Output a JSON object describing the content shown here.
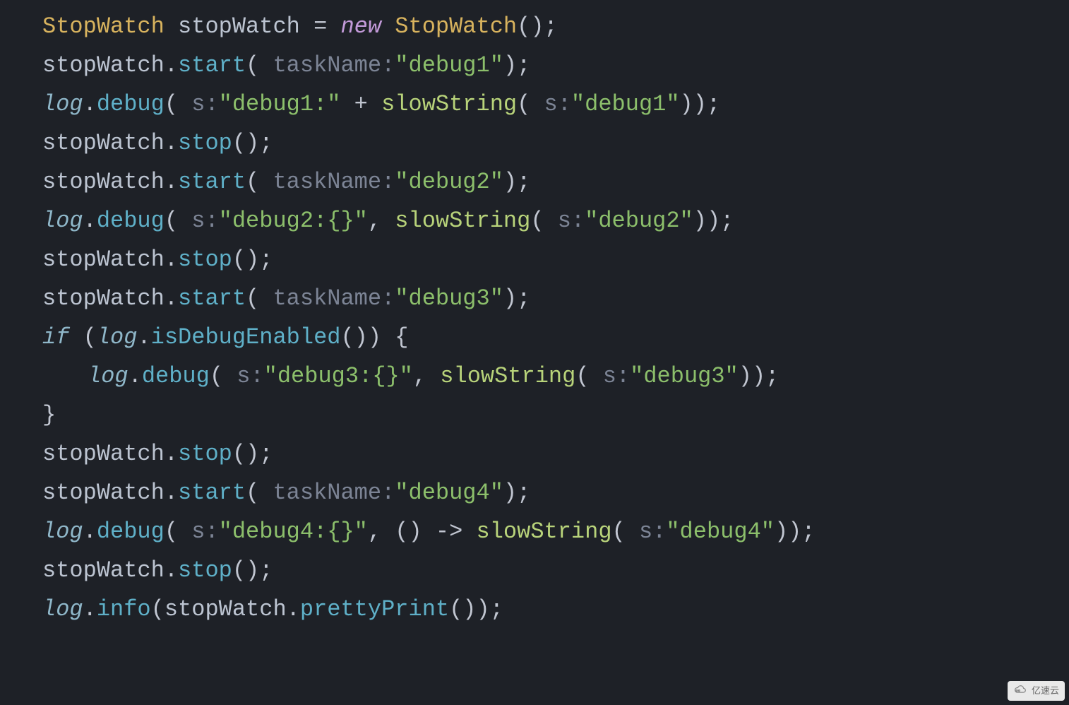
{
  "lines": [
    [
      {
        "t": "StopWatch",
        "c": "cls"
      },
      {
        "t": " ",
        "c": "var"
      },
      {
        "t": "stopWatch",
        "c": "var"
      },
      {
        "t": " = ",
        "c": "op"
      },
      {
        "t": "new",
        "c": "kw"
      },
      {
        "t": " ",
        "c": "var"
      },
      {
        "t": "StopWatch",
        "c": "cls"
      },
      {
        "t": "();",
        "c": "pun"
      }
    ],
    [
      {
        "t": "stopWatch",
        "c": "var"
      },
      {
        "t": ".",
        "c": "pun"
      },
      {
        "t": "start",
        "c": "mth"
      },
      {
        "t": "(",
        "c": "pun"
      },
      {
        "t": " taskName:",
        "c": "par"
      },
      {
        "t": "\"debug1\"",
        "c": "str"
      },
      {
        "t": ");",
        "c": "pun"
      }
    ],
    [
      {
        "t": "log",
        "c": "sta"
      },
      {
        "t": ".",
        "c": "pun"
      },
      {
        "t": "debug",
        "c": "mth"
      },
      {
        "t": "(",
        "c": "pun"
      },
      {
        "t": " s:",
        "c": "par"
      },
      {
        "t": "\"debug1:\"",
        "c": "str"
      },
      {
        "t": " + ",
        "c": "op"
      },
      {
        "t": "slowString",
        "c": "mth2"
      },
      {
        "t": "(",
        "c": "pun"
      },
      {
        "t": " s:",
        "c": "par"
      },
      {
        "t": "\"debug1\"",
        "c": "str"
      },
      {
        "t": "));",
        "c": "pun"
      }
    ],
    [
      {
        "t": "stopWatch",
        "c": "var"
      },
      {
        "t": ".",
        "c": "pun"
      },
      {
        "t": "stop",
        "c": "mth"
      },
      {
        "t": "();",
        "c": "pun"
      }
    ],
    [
      {
        "t": "stopWatch",
        "c": "var"
      },
      {
        "t": ".",
        "c": "pun"
      },
      {
        "t": "start",
        "c": "mth"
      },
      {
        "t": "(",
        "c": "pun"
      },
      {
        "t": " taskName:",
        "c": "par"
      },
      {
        "t": "\"debug2\"",
        "c": "str"
      },
      {
        "t": ");",
        "c": "pun"
      }
    ],
    [
      {
        "t": "log",
        "c": "sta"
      },
      {
        "t": ".",
        "c": "pun"
      },
      {
        "t": "debug",
        "c": "mth"
      },
      {
        "t": "(",
        "c": "pun"
      },
      {
        "t": " s:",
        "c": "par"
      },
      {
        "t": "\"debug2:{}\"",
        "c": "str"
      },
      {
        "t": ", ",
        "c": "pun"
      },
      {
        "t": "slowString",
        "c": "mth2"
      },
      {
        "t": "(",
        "c": "pun"
      },
      {
        "t": " s:",
        "c": "par"
      },
      {
        "t": "\"debug2\"",
        "c": "str"
      },
      {
        "t": "));",
        "c": "pun"
      }
    ],
    [
      {
        "t": "stopWatch",
        "c": "var"
      },
      {
        "t": ".",
        "c": "pun"
      },
      {
        "t": "stop",
        "c": "mth"
      },
      {
        "t": "();",
        "c": "pun"
      }
    ],
    [
      {
        "t": "stopWatch",
        "c": "var"
      },
      {
        "t": ".",
        "c": "pun"
      },
      {
        "t": "start",
        "c": "mth"
      },
      {
        "t": "(",
        "c": "pun"
      },
      {
        "t": " taskName:",
        "c": "par"
      },
      {
        "t": "\"debug3\"",
        "c": "str"
      },
      {
        "t": ");",
        "c": "pun"
      }
    ],
    [
      {
        "t": "if",
        "c": "sta"
      },
      {
        "t": " (",
        "c": "pun"
      },
      {
        "t": "log",
        "c": "sta"
      },
      {
        "t": ".",
        "c": "pun"
      },
      {
        "t": "isDebugEnabled",
        "c": "mth"
      },
      {
        "t": "()) {",
        "c": "pun"
      }
    ],
    [
      {
        "t": "log",
        "c": "sta",
        "indent": 1
      },
      {
        "t": ".",
        "c": "pun"
      },
      {
        "t": "debug",
        "c": "mth"
      },
      {
        "t": "(",
        "c": "pun"
      },
      {
        "t": " s:",
        "c": "par"
      },
      {
        "t": "\"debug3:{}\"",
        "c": "str"
      },
      {
        "t": ", ",
        "c": "pun"
      },
      {
        "t": "slowString",
        "c": "mth2"
      },
      {
        "t": "(",
        "c": "pun"
      },
      {
        "t": " s:",
        "c": "par"
      },
      {
        "t": "\"debug3\"",
        "c": "str"
      },
      {
        "t": "));",
        "c": "pun"
      }
    ],
    [
      {
        "t": "}",
        "c": "pun"
      }
    ],
    [
      {
        "t": "stopWatch",
        "c": "var"
      },
      {
        "t": ".",
        "c": "pun"
      },
      {
        "t": "stop",
        "c": "mth"
      },
      {
        "t": "();",
        "c": "pun"
      }
    ],
    [
      {
        "t": "stopWatch",
        "c": "var"
      },
      {
        "t": ".",
        "c": "pun"
      },
      {
        "t": "start",
        "c": "mth"
      },
      {
        "t": "(",
        "c": "pun"
      },
      {
        "t": " taskName:",
        "c": "par"
      },
      {
        "t": "\"debug4\"",
        "c": "str"
      },
      {
        "t": ");",
        "c": "pun"
      }
    ],
    [
      {
        "t": "log",
        "c": "sta"
      },
      {
        "t": ".",
        "c": "pun"
      },
      {
        "t": "debug",
        "c": "mth"
      },
      {
        "t": "(",
        "c": "pun"
      },
      {
        "t": " s:",
        "c": "par"
      },
      {
        "t": "\"debug4:{}\"",
        "c": "str"
      },
      {
        "t": ", () -> ",
        "c": "pun"
      },
      {
        "t": "slowString",
        "c": "mth2"
      },
      {
        "t": "(",
        "c": "pun"
      },
      {
        "t": " s:",
        "c": "par"
      },
      {
        "t": "\"debug4\"",
        "c": "str"
      },
      {
        "t": "));",
        "c": "pun"
      }
    ],
    [
      {
        "t": "stopWatch",
        "c": "var"
      },
      {
        "t": ".",
        "c": "pun"
      },
      {
        "t": "stop",
        "c": "mth"
      },
      {
        "t": "();",
        "c": "pun"
      }
    ],
    [
      {
        "t": "log",
        "c": "sta"
      },
      {
        "t": ".",
        "c": "pun"
      },
      {
        "t": "info",
        "c": "mth"
      },
      {
        "t": "(",
        "c": "pun"
      },
      {
        "t": "stopWatch",
        "c": "var"
      },
      {
        "t": ".",
        "c": "pun"
      },
      {
        "t": "prettyPrint",
        "c": "mth"
      },
      {
        "t": "());",
        "c": "pun"
      }
    ]
  ],
  "watermark": {
    "label": "亿速云"
  }
}
